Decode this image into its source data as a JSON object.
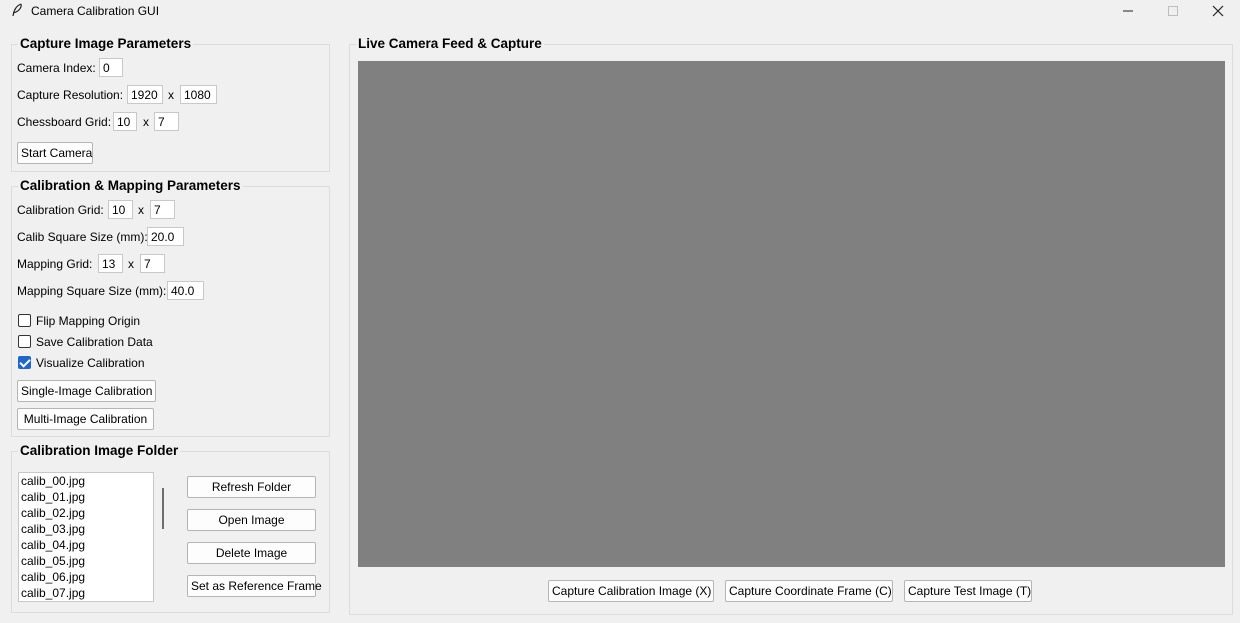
{
  "window": {
    "title": "Camera Calibration GUI"
  },
  "capture_params": {
    "title": "Capture Image Parameters",
    "camera_index_label": "Camera Index:",
    "camera_index_value": "0",
    "resolution_label": "Capture Resolution:",
    "resolution_width": "1920",
    "resolution_sep": "x",
    "resolution_height": "1080",
    "chessboard_label": "Chessboard Grid:",
    "chessboard_cols": "10",
    "chessboard_sep": "x",
    "chessboard_rows": "7",
    "start_camera_label": "Start Camera"
  },
  "calibration_params": {
    "title": "Calibration & Mapping Parameters",
    "calib_grid_label": "Calibration Grid:",
    "calib_grid_cols": "10",
    "calib_grid_sep": "x",
    "calib_grid_rows": "7",
    "calib_square_label": "Calib Square Size (mm):",
    "calib_square_value": "20.0",
    "mapping_grid_label": "Mapping Grid:",
    "mapping_grid_cols": "13",
    "mapping_grid_sep": "x",
    "mapping_grid_rows": "7",
    "mapping_square_label": "Mapping Square Size (mm):",
    "mapping_square_value": "40.0",
    "flip_origin_label": "Flip Mapping Origin",
    "flip_origin_checked": false,
    "save_calib_label": "Save Calibration Data",
    "save_calib_checked": false,
    "visualize_label": "Visualize Calibration",
    "visualize_checked": true,
    "single_image_label": "Single-Image Calibration",
    "multi_image_label": "Multi-Image Calibration"
  },
  "image_folder": {
    "title": "Calibration Image Folder",
    "files": [
      "calib_00.jpg",
      "calib_01.jpg",
      "calib_02.jpg",
      "calib_03.jpg",
      "calib_04.jpg",
      "calib_05.jpg",
      "calib_06.jpg",
      "calib_07.jpg"
    ],
    "refresh_label": "Refresh Folder",
    "open_label": "Open Image",
    "delete_label": "Delete Image",
    "set_reference_label": "Set as Reference Frame"
  },
  "live_feed": {
    "title": "Live Camera Feed & Capture",
    "canvas_color": "#808080",
    "capture_calib_label": "Capture Calibration Image (X)",
    "capture_coord_label": "Capture Coordinate Frame (C)",
    "capture_test_label": "Capture Test Image (T)"
  },
  "colors": {
    "background": "#f0f0f0",
    "checkbox_accent": "#1f68c9"
  }
}
